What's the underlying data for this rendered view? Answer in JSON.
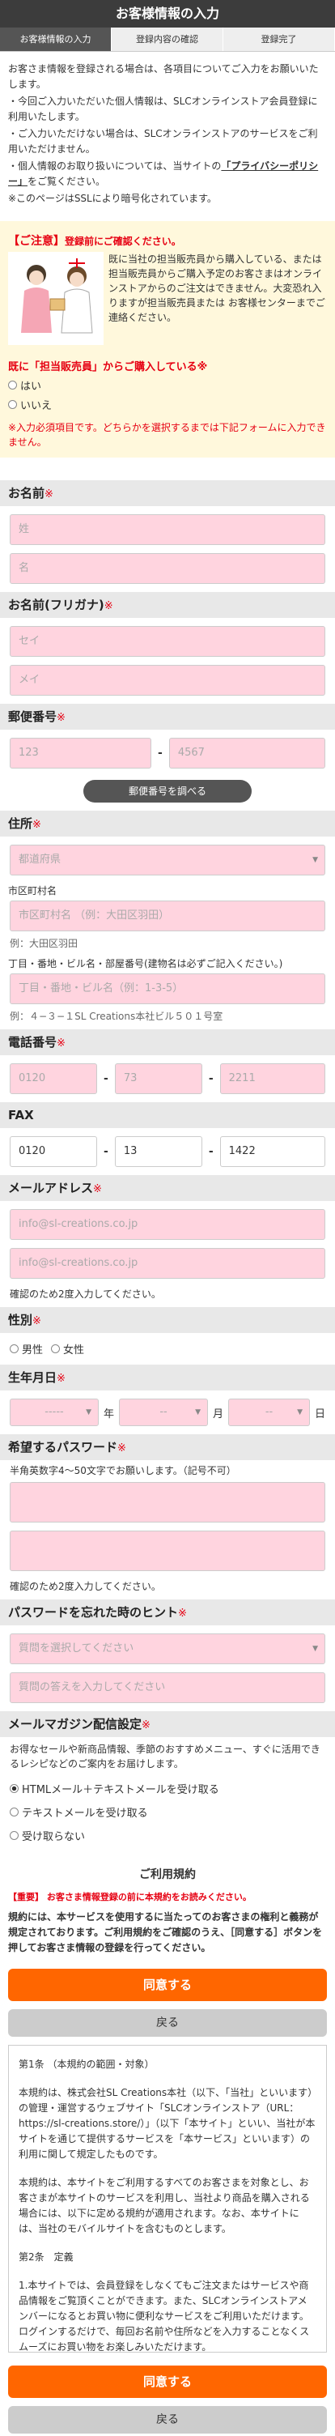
{
  "header": {
    "title": "お客様情報の入力"
  },
  "steps": [
    "お客様情報の入力",
    "登録内容の確認",
    "登録完了"
  ],
  "intro": {
    "p1": "お客さま情報を登録される場合は、各項目についてご入力をお願いいたします。",
    "b1": "・今回ご入力いただいた個人情報は、SLCオンラインストア会員登録に利用いたします。",
    "b2": "・ご入力いただけない場合は、SLCオンラインストアのサービスをご利用いただけません。",
    "b3_pre": "・個人情報のお取り扱いについては、当サイトの",
    "b3_link": "「プライバシーポリシー」",
    "b3_post": "をご覧ください。",
    "p2": "※このページはSSLにより暗号化されています。"
  },
  "notice": {
    "title": "【ご注意】",
    "title_sub": "登録前にご確認ください。",
    "body": "既に当社の担当販売員から購入している、または担当販売員からご購入予定のお客さまはオンラインストアからのご注文はできません。大変恐れ入りますが担当販売員または お客様センターまでご連絡ください。",
    "question": "既に「担当販売員」からご購入している※",
    "options": [
      "はい",
      "いいえ"
    ],
    "warning": "※入力必須項目です。どちらかを選択するまでは下記フォームに入力できません。"
  },
  "name": {
    "label": "お名前",
    "req": "※",
    "last_ph": "姓",
    "first_ph": "名"
  },
  "kana": {
    "label": "お名前(フリガナ)",
    "req": "※",
    "last_ph": "セイ",
    "first_ph": "メイ"
  },
  "zip": {
    "label": "郵便番号",
    "req": "※",
    "part1": "123",
    "part2": "4567",
    "button": "郵便番号を調べる"
  },
  "address": {
    "label": "住所",
    "req": "※",
    "pref_ph": "都道府県",
    "city_label": "市区町村名",
    "city_ph": "市区町村名 （例：大田区羽田）",
    "city_example": "例：大田区羽田",
    "street_label": "丁目・番地・ビル名・部屋番号(建物名は必ずご記入ください。)",
    "street_ph": "丁目・番地・ビル名（例：1-3-5）",
    "street_example": "例：４−３−１SL Creations本社ビル５０１号室"
  },
  "tel": {
    "label": "電話番号",
    "req": "※",
    "p1": "0120",
    "p2": "73",
    "p3": "2211"
  },
  "fax": {
    "label": "FAX",
    "p1": "0120",
    "p2": "13",
    "p3": "1422"
  },
  "email": {
    "label": "メールアドレス",
    "req": "※",
    "value": "info@sl-creations.co.jp",
    "confirm": "info@sl-creations.co.jp",
    "hint": "確認のため2度入力してください。"
  },
  "gender": {
    "label": "性別",
    "req": "※",
    "male": "男性",
    "female": "女性"
  },
  "birth": {
    "label": "生年月日",
    "req": "※",
    "year_ph": "-----",
    "year": "年",
    "month_ph": "--",
    "month": "月",
    "day_ph": "--",
    "day": "日"
  },
  "password": {
    "label": "希望するパスワード",
    "req": "※",
    "hint1": "半角英数字4〜50文字でお願いします。（記号不可）",
    "hint2": "確認のため2度入力してください。"
  },
  "hint_q": {
    "label": "パスワードを忘れた時のヒント",
    "req": "※",
    "q_ph": "質問を選択してください",
    "a_ph": "質問の答えを入力してください"
  },
  "mail": {
    "label": "メールマガジン配信設定",
    "req": "※",
    "desc": "お得なセールや新商品情報、季節のおすすめメニュー、すぐに活用できるレシピなどのご案内をお届けします。",
    "options": [
      "HTMLメール＋テキストメールを受け取る",
      "テキストメールを受け取る",
      "受け取らない"
    ]
  },
  "terms": {
    "title": "ご利用規約",
    "warn": "【重要】 お客さま情報登録の前に本規約をお読みください。",
    "desc": "規約には、本サービスを使用するに当たってのお客さまの権利と義務が規定されております。ご利用規約をご確認のうえ、［同意する］ボタンを押してお客さま情報の登録を行ってください。",
    "agree": "同意する",
    "back": "戻る",
    "art1_title": "第1条 （本規約の範囲・対象）",
    "art1_p1": "本規約は、株式会社SL Creations本社（以下、「当社」といいます）の管理・運営するウェブサイト「SLCオンラインストア（URL：https://sl-creations.store/）」（以下「本サイト」といい、当社が本サイトを通じて提供するサービスを「本サービス」といいます）の利用に関して規定したものです。",
    "art1_p2": "本規約は、本サイトをご利用するすべてのお客さまを対象とし、お客さまが本サイトのサービスを利用し、当社より商品を購入される場合には、以下に定める規約が適用されます。なお、本サイトには、当社のモバイルサイトを含むものとします。",
    "art2_title": "第2条　定義",
    "art2_p1": "1.本サイトでは、会員登録をしなくてもご注文またはサービスや商品情報をご覧頂くことができます。また、SLCオンラインストアメンバーになるとお買い物に便利なサービスをご利用いただけます。ログインするだけで、毎回お名前や住所などを入力することなくスムーズにお買い物をお楽しみいただけます。"
  }
}
